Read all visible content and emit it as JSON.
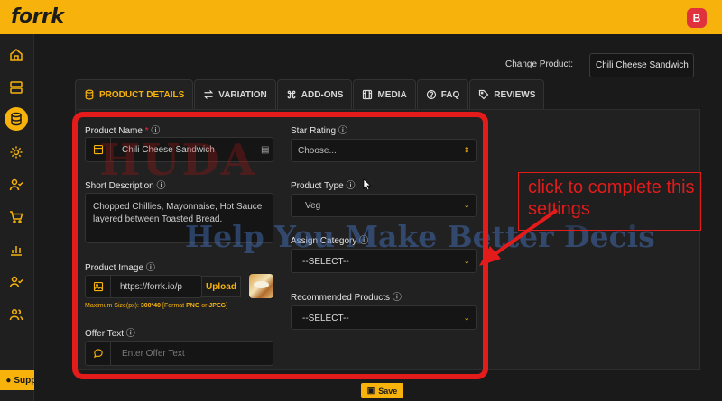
{
  "app": {
    "logo": "forrk",
    "avatar_initial": "B"
  },
  "sidebar": {
    "items": [
      {
        "icon": "home-icon"
      },
      {
        "icon": "server-icon"
      },
      {
        "icon": "database-icon",
        "active": true
      },
      {
        "icon": "gear-icon"
      },
      {
        "icon": "user-check-icon"
      },
      {
        "icon": "cart-icon"
      },
      {
        "icon": "bar-chart-icon"
      },
      {
        "icon": "user-check-icon"
      },
      {
        "icon": "users-icon"
      }
    ],
    "support_label": "Support"
  },
  "header": {
    "change_product_label": "Change Product:",
    "change_product_value": "Chili Cheese Sandwich"
  },
  "tabs": [
    {
      "label": "PRODUCT DETAILS",
      "icon": "database-icon",
      "active": true
    },
    {
      "label": "VARIATION",
      "icon": "swap-icon"
    },
    {
      "label": "ADD-ONS",
      "icon": "command-icon"
    },
    {
      "label": "MEDIA",
      "icon": "film-icon"
    },
    {
      "label": "FAQ",
      "icon": "question-icon"
    },
    {
      "label": "REVIEWS",
      "icon": "tag-icon"
    }
  ],
  "form": {
    "product_name": {
      "label": "Product Name",
      "required": "*",
      "value": "Chili Cheese Sandwich"
    },
    "short_description": {
      "label": "Short Description",
      "value": "Chopped Chillies, Mayonnaise, Hot Sauce layered between Toasted Bread."
    },
    "product_image": {
      "label": "Product Image",
      "value": "https://forrk.io/p",
      "upload_label": "Upload",
      "hint_prefix": "Maximum Size(px):",
      "hint_size": "300*40",
      "hint_format_open": "[Format",
      "hint_png": "PNG",
      "hint_or": "or",
      "hint_jpeg": "JPEG",
      "hint_close": "]"
    },
    "offer_text": {
      "label": "Offer Text",
      "placeholder": "Enter Offer Text"
    },
    "star_rating": {
      "label": "Star Rating",
      "value": "Choose..."
    },
    "product_type": {
      "label": "Product Type",
      "value": "Veg"
    },
    "assign_category": {
      "label": "Assign Category",
      "value": "--SELECT--"
    },
    "recommended_products": {
      "label": "Recommended Products",
      "value": "--SELECT--"
    }
  },
  "save_label": "Save",
  "annotation": {
    "callout": "click to complete this settings"
  },
  "watermark": {
    "line1": "HUDA",
    "line2": "Help You Make Better Decis"
  },
  "colors": {
    "accent": "#f7b30c",
    "annotation_red": "#e31b1b"
  }
}
